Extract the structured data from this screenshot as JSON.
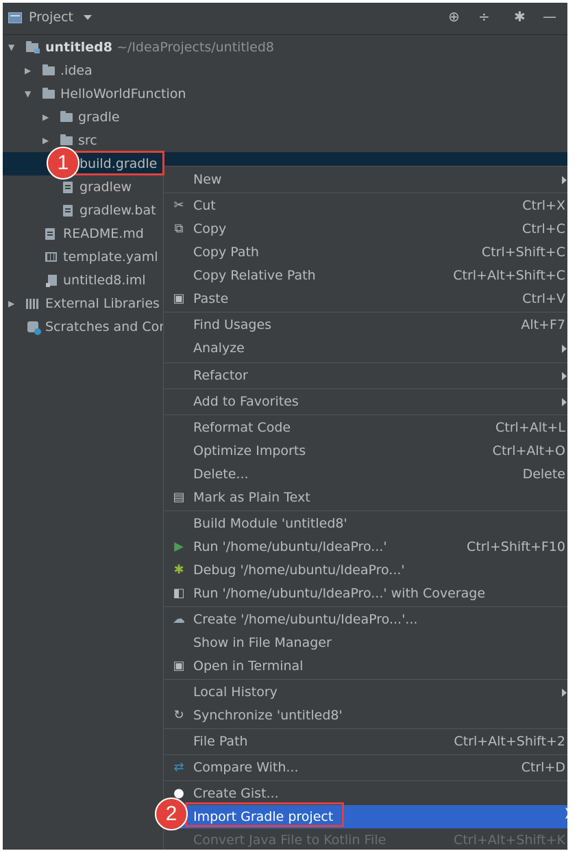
{
  "header": {
    "title": "Project",
    "icons": [
      "crosshair-icon",
      "collapse-icon",
      "gear-icon",
      "minimize-icon"
    ]
  },
  "tree": {
    "items": [
      {
        "label": "untitled8",
        "suffix": "~/IdeaProjects/untitled8",
        "icon": "module-folder-icon",
        "expanded": true
      },
      {
        "label": ".idea",
        "icon": "folder-icon",
        "expanded": false
      },
      {
        "label": "HelloWorldFunction",
        "icon": "folder-icon",
        "expanded": true
      },
      {
        "label": "gradle",
        "icon": "folder-icon",
        "expanded": false
      },
      {
        "label": "src",
        "icon": "folder-icon",
        "expanded": false
      },
      {
        "label": "build.gradle",
        "icon": "gradle-icon",
        "selected": true
      },
      {
        "label": "gradlew",
        "icon": "file-icon"
      },
      {
        "label": "gradlew.bat",
        "icon": "file-icon"
      },
      {
        "label": "README.md",
        "icon": "file-icon"
      },
      {
        "label": "template.yaml",
        "icon": "table-icon"
      },
      {
        "label": "untitled8.iml",
        "icon": "iml-icon"
      },
      {
        "label": "External Libraries",
        "icon": "library-icon",
        "expanded": false
      },
      {
        "label": "Scratches and Consoles",
        "icon": "scratch-icon"
      }
    ]
  },
  "callouts": [
    "1",
    "2"
  ],
  "menu": {
    "items": [
      {
        "label": "New",
        "submenu": true
      },
      {
        "label": "Cut",
        "shortcut": "Ctrl+X",
        "icon": "scissors-icon"
      },
      {
        "label": "Copy",
        "shortcut": "Ctrl+C",
        "icon": "copy-icon"
      },
      {
        "label": "Copy Path",
        "shortcut": "Ctrl+Shift+C"
      },
      {
        "label": "Copy Relative Path",
        "shortcut": "Ctrl+Alt+Shift+C"
      },
      {
        "label": "Paste",
        "shortcut": "Ctrl+V",
        "icon": "clipboard-icon"
      },
      {
        "label": "Find Usages",
        "shortcut": "Alt+F7"
      },
      {
        "label": "Analyze",
        "submenu": true
      },
      {
        "label": "Refactor",
        "submenu": true
      },
      {
        "label": "Add to Favorites",
        "submenu": true
      },
      {
        "label": "Reformat Code",
        "shortcut": "Ctrl+Alt+L"
      },
      {
        "label": "Optimize Imports",
        "shortcut": "Ctrl+Alt+O"
      },
      {
        "label": "Delete...",
        "shortcut": "Delete"
      },
      {
        "label": "Mark as Plain Text",
        "icon": "plain-text-icon"
      },
      {
        "label": "Build Module 'untitled8'"
      },
      {
        "label": "Run '/home/ubuntu/IdeaPro...'",
        "shortcut": "Ctrl+Shift+F10",
        "icon": "run-icon"
      },
      {
        "label": "Debug '/home/ubuntu/IdeaPro...'",
        "icon": "debug-icon"
      },
      {
        "label": "Run '/home/ubuntu/IdeaPro...' with Coverage",
        "icon": "coverage-icon"
      },
      {
        "label": "Create '/home/ubuntu/IdeaPro...'...",
        "icon": "gradle-create-icon"
      },
      {
        "label": "Show in File Manager"
      },
      {
        "label": "Open in Terminal",
        "icon": "terminal-icon"
      },
      {
        "label": "Local History",
        "submenu": true
      },
      {
        "label": "Synchronize 'untitled8'",
        "icon": "sync-icon"
      },
      {
        "label": "File Path",
        "shortcut": "Ctrl+Alt+Shift+2"
      },
      {
        "label": "Compare With...",
        "shortcut": "Ctrl+D",
        "icon": "compare-icon"
      },
      {
        "label": "Create Gist...",
        "icon": "github-icon"
      },
      {
        "label": "Import Gradle project",
        "highlighted": true
      },
      {
        "label": "Convert Java File to Kotlin File",
        "shortcut": "Ctrl+Alt+Shift+K",
        "disabled": true
      }
    ]
  },
  "colors": {
    "highlight": "#2f65ca",
    "callout": "#e2413b",
    "background": "#3c3f41"
  }
}
